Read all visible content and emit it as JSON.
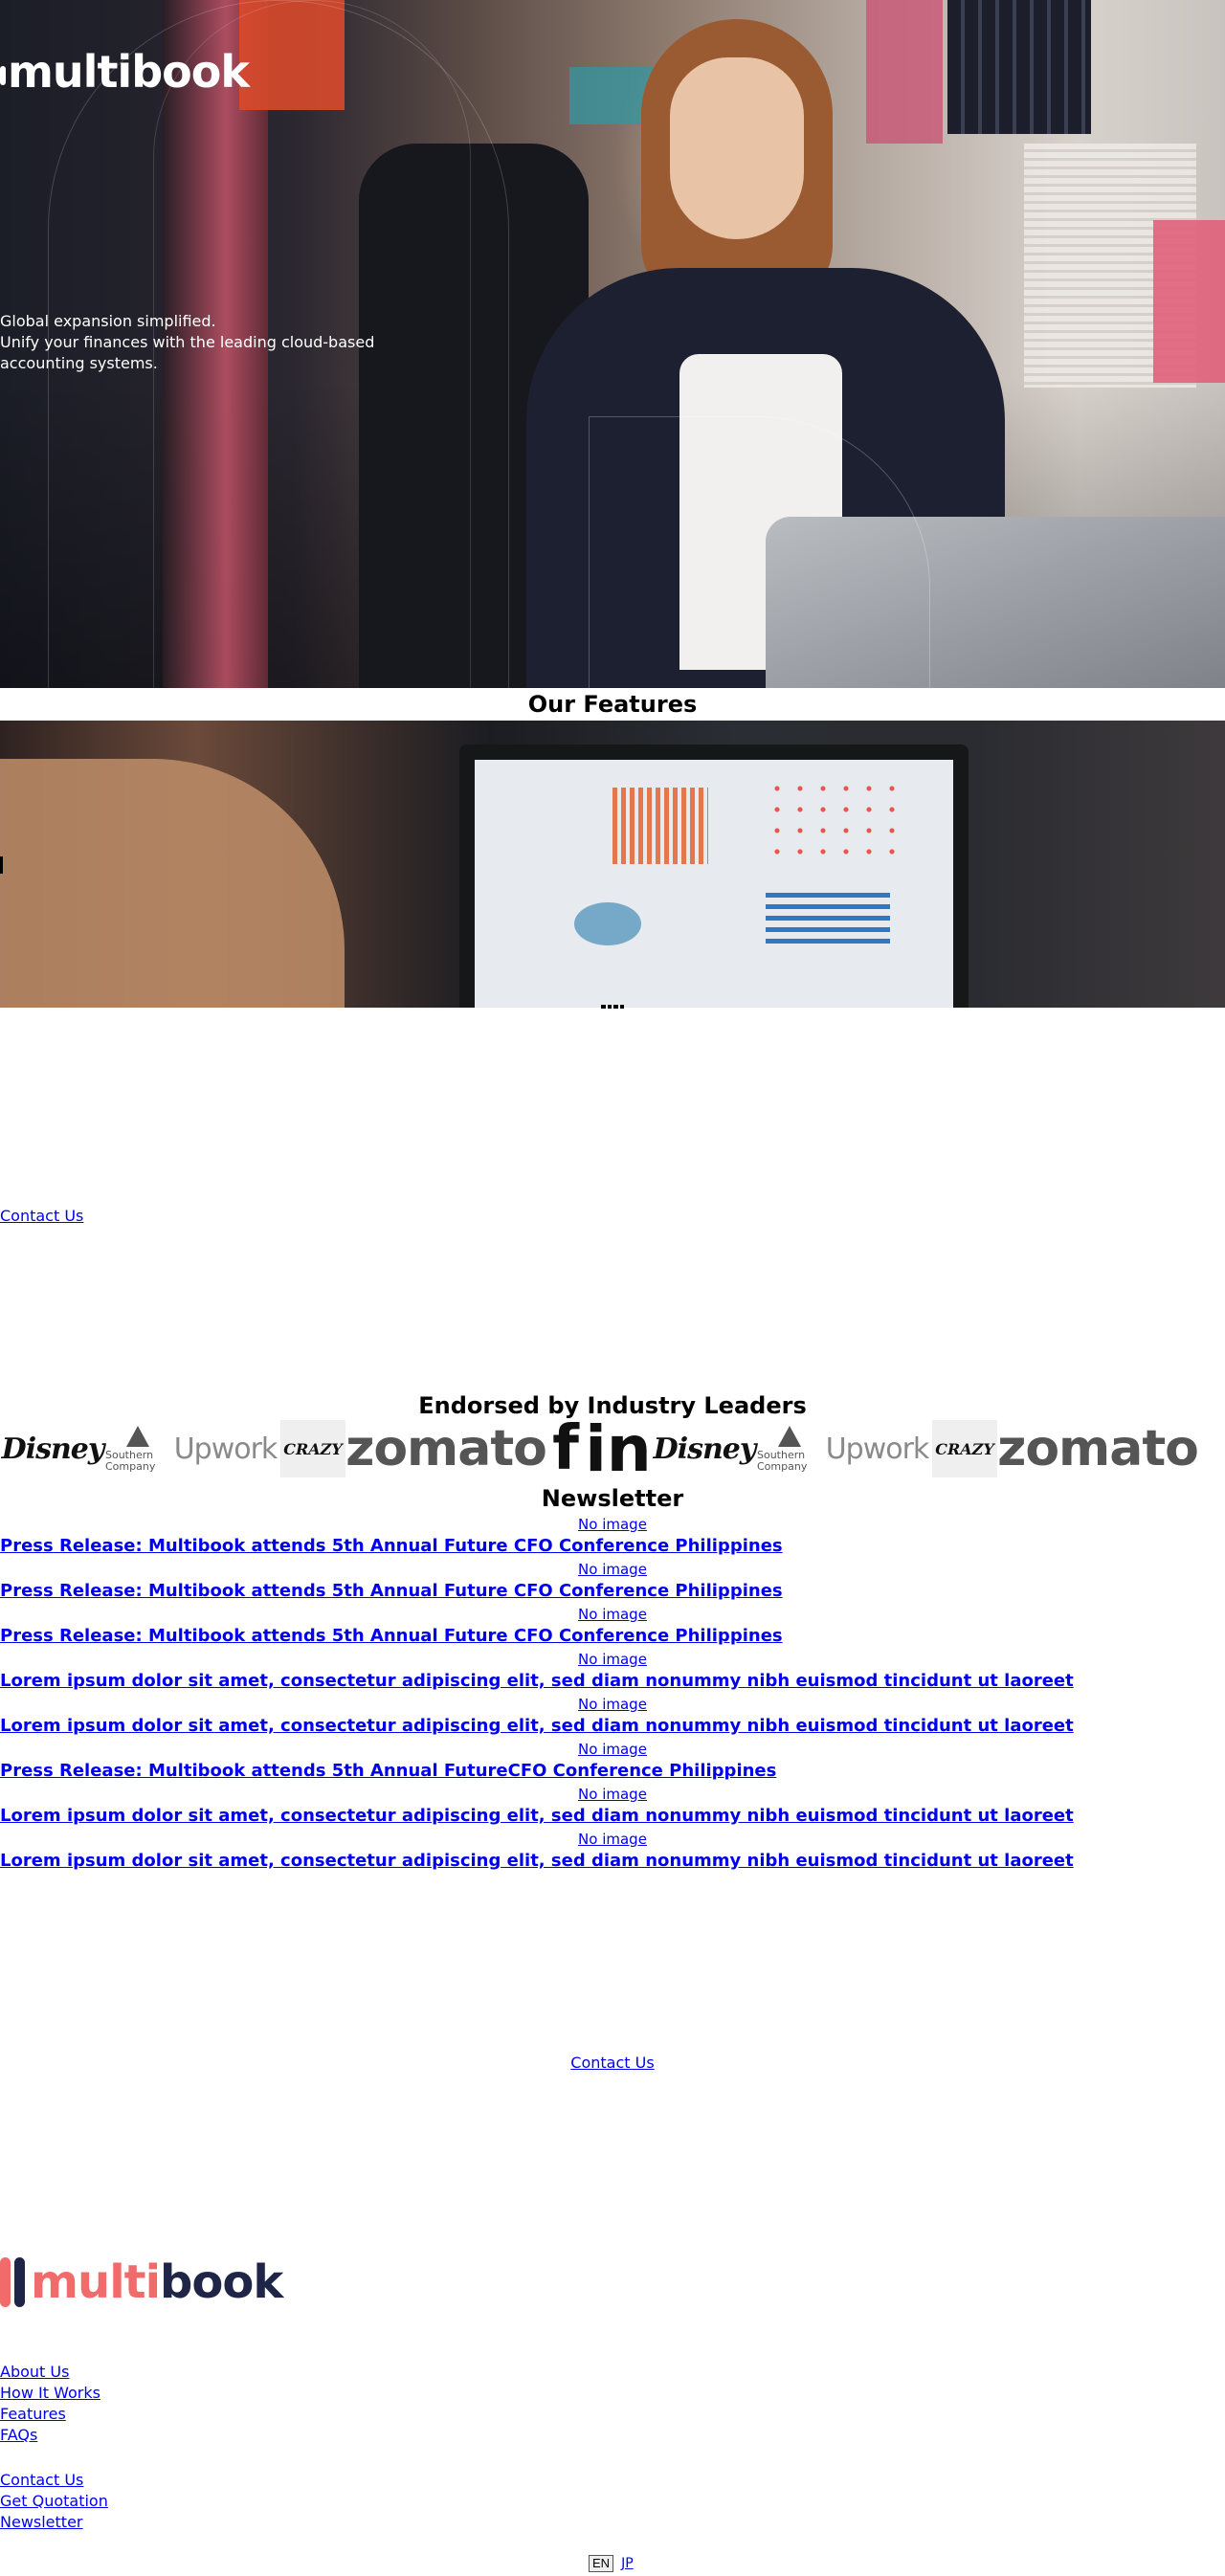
{
  "hero": {
    "logo_text": "multibook",
    "tagline_1": "Global expansion simplified.",
    "tagline_2": "Unify your finances with the leading cloud-based accounting systems."
  },
  "features": {
    "title": "Our Features"
  },
  "contact_top": {
    "label": "Contact Us"
  },
  "endorsed": {
    "title": "Endorsed by Industry Leaders",
    "logos": [
      {
        "name": "Disney",
        "text": "Disney"
      },
      {
        "name": "Southern Company",
        "text": "Southern Company"
      },
      {
        "name": "Upwork",
        "text": "Upwork"
      },
      {
        "name": "Crazy",
        "text": "CRAZY"
      },
      {
        "name": "Zomato",
        "text": "zomato"
      },
      {
        "name": "Facebook",
        "text": "f"
      },
      {
        "name": "LinkedIn",
        "text": "in"
      },
      {
        "name": "Disney",
        "text": "Disney"
      },
      {
        "name": "Southern Company",
        "text": "Southern Company"
      },
      {
        "name": "Upwork",
        "text": "Upwork"
      },
      {
        "name": "Crazy",
        "text": "CRAZY"
      },
      {
        "name": "Zomato",
        "text": "zomato"
      }
    ]
  },
  "newsletter": {
    "title": "Newsletter",
    "items": [
      {
        "image_alt": "No image",
        "title": "Press Release: Multibook attends 5th Annual Future CFO Conference Philippines"
      },
      {
        "image_alt": "No image",
        "title": "Press Release: Multibook attends 5th Annual Future CFO Conference Philippines"
      },
      {
        "image_alt": "No image",
        "title": "Press Release: Multibook attends 5th Annual Future CFO Conference Philippines"
      },
      {
        "image_alt": "No image",
        "title": "Lorem ipsum dolor sit amet, consectetur adipiscing elit, sed diam nonummy nibh euismod tincidunt ut laoreet"
      },
      {
        "image_alt": "No image",
        "title": "Lorem ipsum dolor sit amet, consectetur adipiscing elit, sed diam nonummy nibh euismod tincidunt ut laoreet"
      },
      {
        "image_alt": "No image",
        "title": "Press Release: Multibook attends 5th Annual FutureCFO Conference Philippines"
      },
      {
        "image_alt": "No image",
        "title": "Lorem ipsum dolor sit amet, consectetur adipiscing elit, sed diam nonummy nibh euismod tincidunt ut laoreet"
      },
      {
        "image_alt": "No image",
        "title": "Lorem ipsum dolor sit amet, consectetur adipiscing elit, sed diam nonummy nibh euismod tincidunt ut laoreet"
      }
    ]
  },
  "contact_bottom": {
    "label": "Contact Us"
  },
  "footer": {
    "logo_part_1": "multi",
    "logo_part_2": "book",
    "col1": [
      "About Us",
      "How It Works",
      "Features",
      "FAQs"
    ],
    "col2": [
      "Contact Us",
      "Get Quotation",
      "Newsletter"
    ],
    "lang_en": "EN",
    "lang_jp": "JP"
  },
  "colors": {
    "brand_coral": "#f26b6b",
    "brand_navy": "#1f2547",
    "link": "#0000ee"
  }
}
